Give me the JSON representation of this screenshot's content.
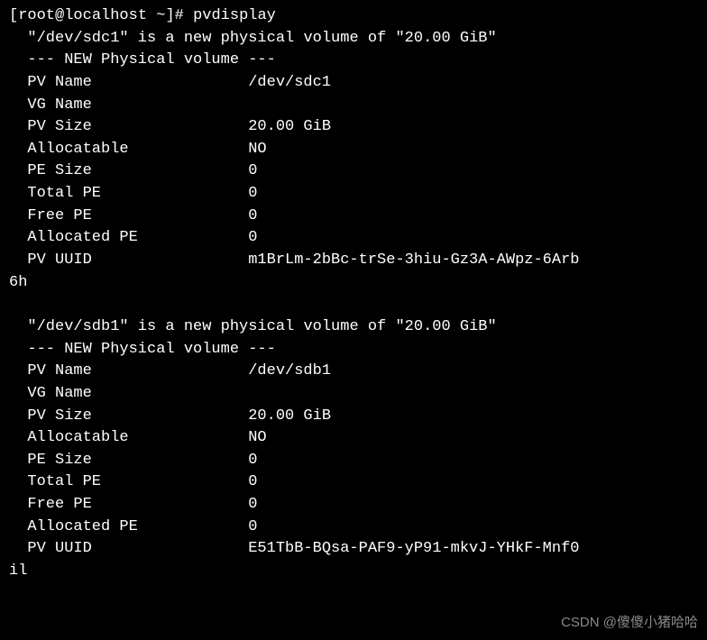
{
  "prompt": {
    "user": "root",
    "host": "localhost",
    "path": "~",
    "symbol": "#",
    "command": "pvdisplay"
  },
  "volumes": [
    {
      "intro_device": "\"/dev/sdc1\"",
      "intro_mid": " is a new physical volume of ",
      "intro_size": "\"20.00 GiB\"",
      "header": "--- NEW Physical volume ---",
      "fields": {
        "pv_name_label": "PV Name",
        "pv_name_value": "/dev/sdc1",
        "vg_name_label": "VG Name",
        "vg_name_value": "",
        "pv_size_label": "PV Size",
        "pv_size_value": "20.00 GiB",
        "allocatable_label": "Allocatable",
        "allocatable_value": "NO",
        "pe_size_label": "PE Size",
        "pe_size_value": "0",
        "total_pe_label": "Total PE",
        "total_pe_value": "0",
        "free_pe_label": "Free PE",
        "free_pe_value": "0",
        "allocated_pe_label": "Allocated PE",
        "allocated_pe_value": "0",
        "uuid_label": "PV UUID",
        "uuid_value": "m1BrLm-2bBc-trSe-3hiu-Gz3A-AWpz-6Arb",
        "uuid_wrap": "6h"
      }
    },
    {
      "intro_device": "\"/dev/sdb1\"",
      "intro_mid": " is a new physical volume of ",
      "intro_size": "\"20.00 GiB\"",
      "header": "--- NEW Physical volume ---",
      "fields": {
        "pv_name_label": "PV Name",
        "pv_name_value": "/dev/sdb1",
        "vg_name_label": "VG Name",
        "vg_name_value": "",
        "pv_size_label": "PV Size",
        "pv_size_value": "20.00 GiB",
        "allocatable_label": "Allocatable",
        "allocatable_value": "NO",
        "pe_size_label": "PE Size",
        "pe_size_value": "0",
        "total_pe_label": "Total PE",
        "total_pe_value": "0",
        "free_pe_label": "Free PE",
        "free_pe_value": "0",
        "allocated_pe_label": "Allocated PE",
        "allocated_pe_value": "0",
        "uuid_label": "PV UUID",
        "uuid_value": "E51TbB-BQsa-PAF9-yP91-mkvJ-YHkF-Mnf0",
        "uuid_wrap": "il"
      }
    }
  ],
  "watermark": "CSDN @傻傻小猪哈哈"
}
